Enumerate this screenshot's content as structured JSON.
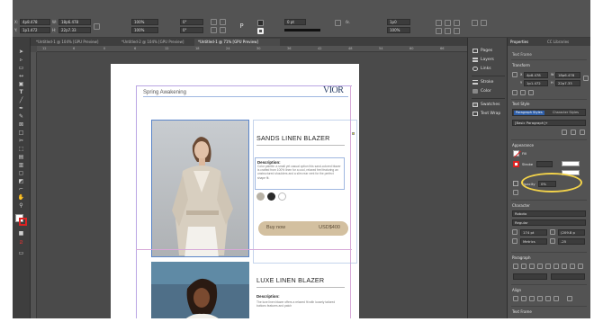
{
  "control_bar": {
    "x_value": "4p8.478",
    "y_value": "1p1.472",
    "w_value": "18p6.478",
    "h_value": "22p7.33",
    "scale_x": "100%",
    "scale_y": "100%",
    "angle": "0°",
    "shear": "0°",
    "stroke_weight": "0 pt",
    "fx_label": "fx.",
    "gap_value": "1p0",
    "opacity_value": "100%"
  },
  "document_tabs": [
    "*Untitled-1 @ 104% [GPU Preview]",
    "*Untitled-2 @ 104% [GPU Preview]",
    "*Untitled-1 @ 71% [GPU Preview]"
  ],
  "ruler_ticks": [
    "12",
    "6",
    "0",
    "6",
    "12",
    "18",
    "24",
    "30",
    "36",
    "42",
    "48",
    "54",
    "60",
    "66"
  ],
  "page": {
    "header_text": "Spring Awakening",
    "logo_text": "VIOR",
    "product1": {
      "title": "SANDS LINEN BLAZER",
      "desc_heading": "Description:",
      "desc_body": "Color palette: a small yet casual option this sand-colored blazer is crafted from 100% linen for a cool, relaxed feel featuring an unstructured shoulders and a slim rear vent for the perfect shape fit.",
      "swatches": [
        "#b8b2a6",
        "#2a2a2a",
        "#ffffff"
      ],
      "buy_label": "Buy now",
      "price": "USD$400"
    },
    "product2": {
      "title": "LUXE LINEN BLAZER",
      "desc_heading": "Description:",
      "desc_body": "The luxe linen blazer offers a relaxed fit with loosely tailored buttons features and patch"
    }
  },
  "dock_panels": [
    {
      "label": "Pages",
      "icon": "pages-icon"
    },
    {
      "label": "Layers",
      "icon": "layers-icon"
    },
    {
      "label": "Links",
      "icon": "links-icon"
    },
    {
      "label": "Stroke",
      "icon": "stroke-icon"
    },
    {
      "label": "Color",
      "icon": "color-icon"
    },
    {
      "label": "Swatches",
      "icon": "swatches-icon"
    },
    {
      "label": "Text Wrap",
      "icon": "text-wrap-icon"
    }
  ],
  "properties": {
    "tab_properties": "Properties",
    "tab_cc": "CC Libraries",
    "context": "Text Frame",
    "transform_heading": "Transform",
    "x": "4p8.478",
    "y": "1p1.472",
    "w": "18p6.478",
    "h": "22p7.33",
    "text_style_heading": "Text Style",
    "paragraph_styles": "Paragraph Styles",
    "character_styles": "Character Styles",
    "para_style_value": "[Basic Paragraph]+",
    "appearance_heading": "Appearance",
    "fill_label": "Fill",
    "stroke_label": "Stroke",
    "opacity_label": "Opacity",
    "opacity_value": "0%",
    "character_heading": "Character",
    "font_family": "Roboto",
    "font_style": "Regular",
    "font_size": "174 pt",
    "leading": "(209.8 p",
    "kerning": "Metrics",
    "tracking": "-25",
    "paragraph_heading": "Paragraph",
    "align_heading": "Align",
    "text_frame_heading": "Text Frame",
    "accent_color": "#f3d34a"
  }
}
